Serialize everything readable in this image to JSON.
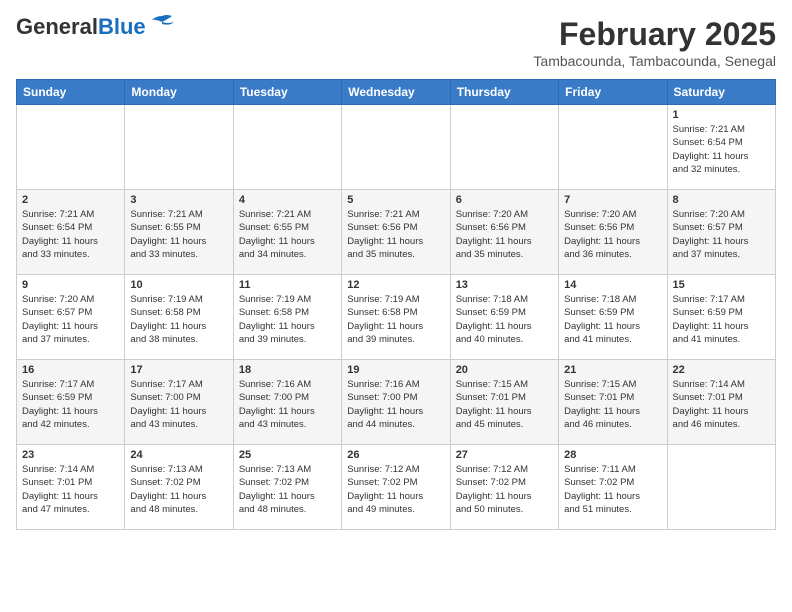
{
  "header": {
    "logo_general": "General",
    "logo_blue": "Blue",
    "title": "February 2025",
    "subtitle": "Tambacounda, Tambacounda, Senegal"
  },
  "weekdays": [
    "Sunday",
    "Monday",
    "Tuesday",
    "Wednesday",
    "Thursday",
    "Friday",
    "Saturday"
  ],
  "weeks": [
    [
      {
        "day": "",
        "info": ""
      },
      {
        "day": "",
        "info": ""
      },
      {
        "day": "",
        "info": ""
      },
      {
        "day": "",
        "info": ""
      },
      {
        "day": "",
        "info": ""
      },
      {
        "day": "",
        "info": ""
      },
      {
        "day": "1",
        "info": "Sunrise: 7:21 AM\nSunset: 6:54 PM\nDaylight: 11 hours\nand 32 minutes."
      }
    ],
    [
      {
        "day": "2",
        "info": "Sunrise: 7:21 AM\nSunset: 6:54 PM\nDaylight: 11 hours\nand 33 minutes."
      },
      {
        "day": "3",
        "info": "Sunrise: 7:21 AM\nSunset: 6:55 PM\nDaylight: 11 hours\nand 33 minutes."
      },
      {
        "day": "4",
        "info": "Sunrise: 7:21 AM\nSunset: 6:55 PM\nDaylight: 11 hours\nand 34 minutes."
      },
      {
        "day": "5",
        "info": "Sunrise: 7:21 AM\nSunset: 6:56 PM\nDaylight: 11 hours\nand 35 minutes."
      },
      {
        "day": "6",
        "info": "Sunrise: 7:20 AM\nSunset: 6:56 PM\nDaylight: 11 hours\nand 35 minutes."
      },
      {
        "day": "7",
        "info": "Sunrise: 7:20 AM\nSunset: 6:56 PM\nDaylight: 11 hours\nand 36 minutes."
      },
      {
        "day": "8",
        "info": "Sunrise: 7:20 AM\nSunset: 6:57 PM\nDaylight: 11 hours\nand 37 minutes."
      }
    ],
    [
      {
        "day": "9",
        "info": "Sunrise: 7:20 AM\nSunset: 6:57 PM\nDaylight: 11 hours\nand 37 minutes."
      },
      {
        "day": "10",
        "info": "Sunrise: 7:19 AM\nSunset: 6:58 PM\nDaylight: 11 hours\nand 38 minutes."
      },
      {
        "day": "11",
        "info": "Sunrise: 7:19 AM\nSunset: 6:58 PM\nDaylight: 11 hours\nand 39 minutes."
      },
      {
        "day": "12",
        "info": "Sunrise: 7:19 AM\nSunset: 6:58 PM\nDaylight: 11 hours\nand 39 minutes."
      },
      {
        "day": "13",
        "info": "Sunrise: 7:18 AM\nSunset: 6:59 PM\nDaylight: 11 hours\nand 40 minutes."
      },
      {
        "day": "14",
        "info": "Sunrise: 7:18 AM\nSunset: 6:59 PM\nDaylight: 11 hours\nand 41 minutes."
      },
      {
        "day": "15",
        "info": "Sunrise: 7:17 AM\nSunset: 6:59 PM\nDaylight: 11 hours\nand 41 minutes."
      }
    ],
    [
      {
        "day": "16",
        "info": "Sunrise: 7:17 AM\nSunset: 6:59 PM\nDaylight: 11 hours\nand 42 minutes."
      },
      {
        "day": "17",
        "info": "Sunrise: 7:17 AM\nSunset: 7:00 PM\nDaylight: 11 hours\nand 43 minutes."
      },
      {
        "day": "18",
        "info": "Sunrise: 7:16 AM\nSunset: 7:00 PM\nDaylight: 11 hours\nand 43 minutes."
      },
      {
        "day": "19",
        "info": "Sunrise: 7:16 AM\nSunset: 7:00 PM\nDaylight: 11 hours\nand 44 minutes."
      },
      {
        "day": "20",
        "info": "Sunrise: 7:15 AM\nSunset: 7:01 PM\nDaylight: 11 hours\nand 45 minutes."
      },
      {
        "day": "21",
        "info": "Sunrise: 7:15 AM\nSunset: 7:01 PM\nDaylight: 11 hours\nand 46 minutes."
      },
      {
        "day": "22",
        "info": "Sunrise: 7:14 AM\nSunset: 7:01 PM\nDaylight: 11 hours\nand 46 minutes."
      }
    ],
    [
      {
        "day": "23",
        "info": "Sunrise: 7:14 AM\nSunset: 7:01 PM\nDaylight: 11 hours\nand 47 minutes."
      },
      {
        "day": "24",
        "info": "Sunrise: 7:13 AM\nSunset: 7:02 PM\nDaylight: 11 hours\nand 48 minutes."
      },
      {
        "day": "25",
        "info": "Sunrise: 7:13 AM\nSunset: 7:02 PM\nDaylight: 11 hours\nand 48 minutes."
      },
      {
        "day": "26",
        "info": "Sunrise: 7:12 AM\nSunset: 7:02 PM\nDaylight: 11 hours\nand 49 minutes."
      },
      {
        "day": "27",
        "info": "Sunrise: 7:12 AM\nSunset: 7:02 PM\nDaylight: 11 hours\nand 50 minutes."
      },
      {
        "day": "28",
        "info": "Sunrise: 7:11 AM\nSunset: 7:02 PM\nDaylight: 11 hours\nand 51 minutes."
      },
      {
        "day": "",
        "info": ""
      }
    ]
  ]
}
